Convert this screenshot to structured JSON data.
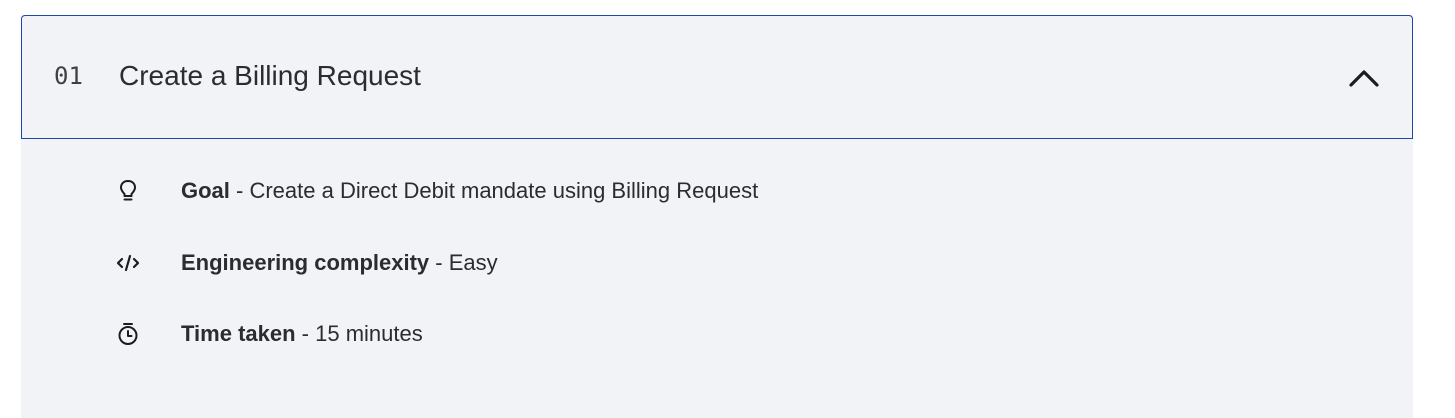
{
  "accordion": {
    "step_number": "01",
    "title": "Create a Billing Request",
    "toggle_icon": "chevron-up-icon",
    "expanded": true,
    "border_color": "#1f47a8",
    "background_color": "#f2f3f6"
  },
  "details": [
    {
      "icon": "lightbulb-icon",
      "label": "Goal",
      "separator": " - ",
      "value": "Create a Direct Debit mandate using Billing Request"
    },
    {
      "icon": "code-icon",
      "label": "Engineering complexity",
      "separator": " - ",
      "value": "Easy"
    },
    {
      "icon": "stopwatch-icon",
      "label": "Time taken",
      "separator": " - ",
      "value": "15 minutes"
    }
  ]
}
